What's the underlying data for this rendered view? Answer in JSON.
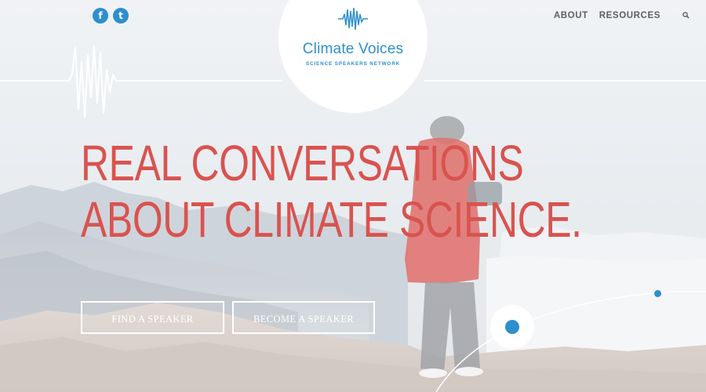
{
  "brand": {
    "title": "Climate Voices",
    "subtitle": "SCIENCE SPEAKERS NETWORK",
    "accent_color": "#2e8fce",
    "headline_color": "#d9534f"
  },
  "social": {
    "facebook_label": "f",
    "twitter_label": "t",
    "facebook_icon": "facebook-icon",
    "twitter_icon": "twitter-icon"
  },
  "nav": {
    "items": [
      {
        "label": "ABOUT"
      },
      {
        "label": "RESOURCES"
      }
    ],
    "search_icon": "search-icon"
  },
  "hero": {
    "headline_line1": "REAL CONVERSATIONS",
    "headline_line2": "ABOUT CLIMATE SCIENCE.",
    "background": "photo of a person in a red parka on a snowy mountain summit"
  },
  "actions": {
    "find_speaker": "FIND A SPEAKER",
    "become_speaker": "BECOME A SPEAKER"
  }
}
